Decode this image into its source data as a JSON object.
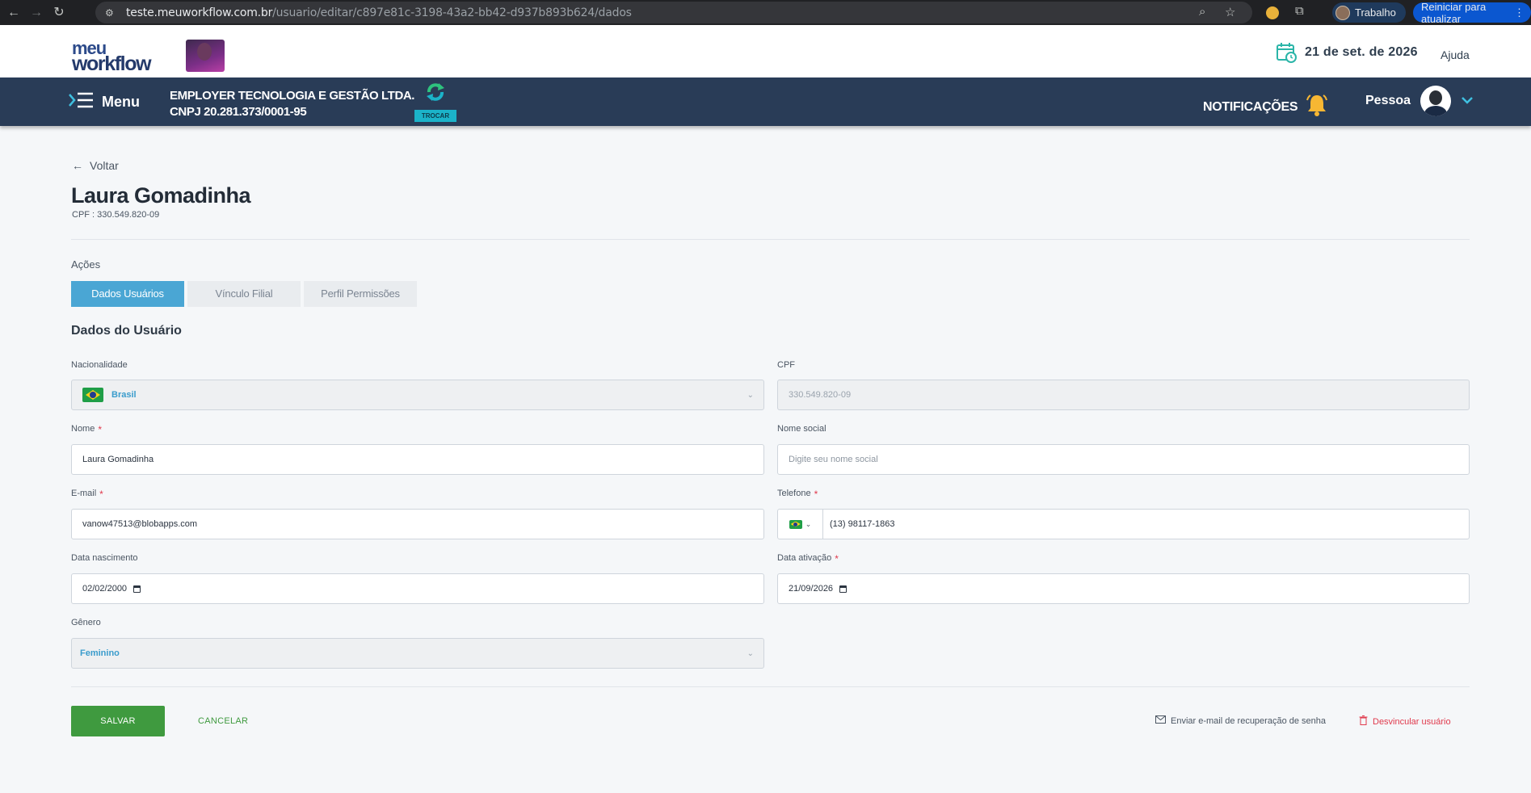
{
  "browser": {
    "url_host": "teste.meuworkflow.com.br",
    "url_path": "/usuario/editar/c897e81c-3198-43a2-bb42-d937b893b624/dados",
    "profile_label": "Trabalho",
    "update_label": "Reiniciar para atualizar"
  },
  "header": {
    "logo_line1": "meu",
    "logo_line2": "workflow",
    "date": "21 de set. de 2026",
    "help": "Ajuda"
  },
  "navbar": {
    "menu_label": "Menu",
    "company_name": "EMPLOYER TECNOLOGIA E GESTÃO LTDA.",
    "company_cnpj": "CNPJ 20.281.373/0001-95",
    "switch_label": "TROCAR",
    "notifications_label": "NOTIFICAÇÕES",
    "user_name": "Pessoa"
  },
  "page": {
    "back_label": "Voltar",
    "title": "Laura Gomadinha",
    "subtitle": "CPF : 330.549.820-09",
    "actions_label": "Ações",
    "tabs": [
      {
        "label": "Dados Usuários"
      },
      {
        "label": "Vínculo Filial"
      },
      {
        "label": "Perfil Permissões"
      }
    ],
    "section_title": "Dados do Usuário"
  },
  "form": {
    "nationality": {
      "label": "Nacionalidade",
      "value": "Brasil"
    },
    "cpf": {
      "label": "CPF",
      "value": "330.549.820-09"
    },
    "name": {
      "label": "Nome",
      "value": "Laura Gomadinha"
    },
    "social_name": {
      "label": "Nome social",
      "placeholder": "Digite seu nome social"
    },
    "email": {
      "label": "E-mail",
      "value": "vanow47513@blobapps.com"
    },
    "phone": {
      "label": "Telefone",
      "value": "(13) 98117-1863"
    },
    "birth_date": {
      "label": "Data nascimento",
      "value": "02/02/2000"
    },
    "activation_date": {
      "label": "Data ativação",
      "value": "21/09/2026"
    },
    "gender": {
      "label": "Gênero",
      "value": "Feminino"
    },
    "required_mark": "*"
  },
  "footer": {
    "save_label": "SALVAR",
    "cancel_label": "CANCELAR",
    "recover_label": "Enviar e-mail de recuperação de senha",
    "unlink_label": "Desvincular usuário"
  },
  "colors": {
    "navbar": "#293c57",
    "active_tab": "#4aa6d4",
    "save": "#3f9a3f",
    "danger": "#e0394c"
  },
  "icons": [
    "back-arrow-icon",
    "forward-arrow-icon",
    "reload-icon",
    "site-info-icon",
    "zoom-icon",
    "star-icon",
    "extensions-icon",
    "calendar-icon",
    "menu-icon",
    "switch-icon",
    "bell-icon",
    "chevron-down-icon",
    "mail-icon",
    "trash-icon"
  ]
}
